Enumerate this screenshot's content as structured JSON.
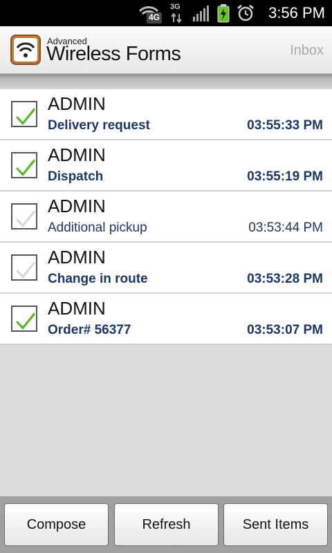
{
  "status_bar": {
    "time": "3:56 PM",
    "icons": [
      "wifi-4g-icon",
      "3g-data-icon",
      "signal-icon",
      "battery-charging-icon",
      "alarm-icon"
    ],
    "network_label": "4G",
    "data_label": "3G"
  },
  "header": {
    "app_name_small": "Advanced",
    "app_name_large": "Wireless Forms",
    "screen_label": "Inbox"
  },
  "messages": [
    {
      "sender": "ADMIN",
      "subject": "Delivery request",
      "time": "03:55:33 PM",
      "checked": true,
      "bold": true
    },
    {
      "sender": "ADMIN",
      "subject": "Dispatch",
      "time": "03:55:19 PM",
      "checked": true,
      "bold": true
    },
    {
      "sender": "ADMIN",
      "subject": "Additional pickup",
      "time": "03:53:44 PM",
      "checked": false,
      "bold": false
    },
    {
      "sender": "ADMIN",
      "subject": "Change in route",
      "time": "03:53:28 PM",
      "checked": false,
      "bold": true
    },
    {
      "sender": "ADMIN",
      "subject": "Order# 56377",
      "time": "03:53:07 PM",
      "checked": true,
      "bold": true
    }
  ],
  "buttons": {
    "compose": "Compose",
    "refresh": "Refresh",
    "sent_items": "Sent Items"
  },
  "colors": {
    "check_active": "#5cb82e",
    "check_inactive": "#d0d0d0",
    "subject_text": "#1a3766"
  }
}
